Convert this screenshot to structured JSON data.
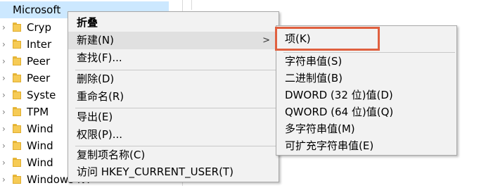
{
  "tree": {
    "root": "Microsoft",
    "children": [
      "Cryp",
      "Inter",
      "Peer",
      "Peer",
      "Syste",
      "TPM",
      "Wind",
      "Wind",
      "Wind",
      "Windows NT"
    ]
  },
  "context_menu": {
    "items": [
      {
        "label": "折叠"
      },
      {
        "label": "新建(N)",
        "arrow": ">"
      },
      {
        "label": "查找(F)..."
      },
      {
        "label": "删除(D)"
      },
      {
        "label": "重命名(R)"
      },
      {
        "label": "导出(E)"
      },
      {
        "label": "权限(P)..."
      },
      {
        "label": "复制项名称(C)"
      },
      {
        "label": "访问 HKEY_CURRENT_USER(T)"
      }
    ]
  },
  "submenu": {
    "items": [
      {
        "label": "项(K)"
      },
      {
        "label": "字符串值(S)"
      },
      {
        "label": "二进制值(B)"
      },
      {
        "label": "DWORD (32 位)值(D)"
      },
      {
        "label": "QWORD (64 位)值(Q)"
      },
      {
        "label": "多字符串值(M)"
      },
      {
        "label": "可扩充字符串值(E)"
      }
    ]
  },
  "colors": {
    "highlight_border": "#e0603f",
    "selection": "#cce8ff",
    "menu_bg": "#f2f2f2"
  }
}
